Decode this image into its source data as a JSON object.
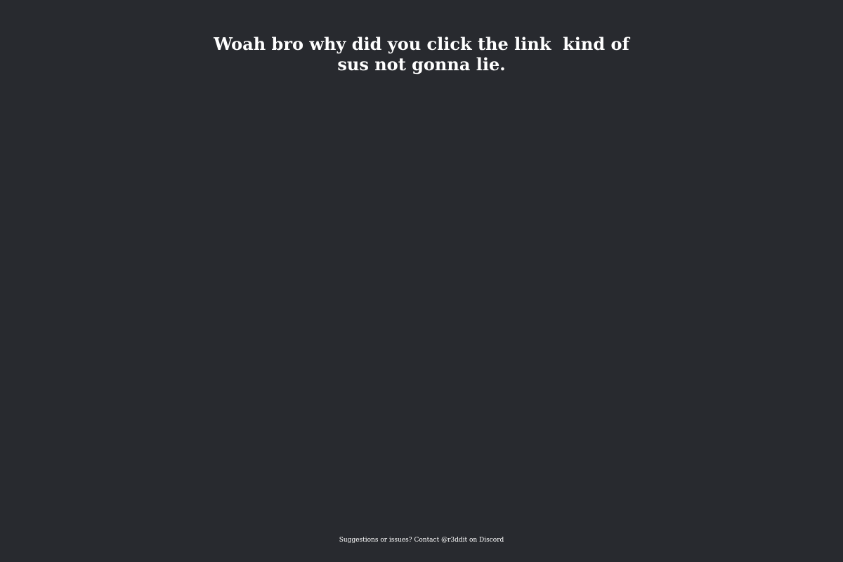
{
  "page": {
    "headline": "Woah bro why did you click the link  kind of sus not gonna lie.",
    "footer": "Suggestions or issues? Contact @r3ddit on Discord"
  },
  "colors": {
    "background": "#282a2f",
    "text": "#ffffff"
  }
}
